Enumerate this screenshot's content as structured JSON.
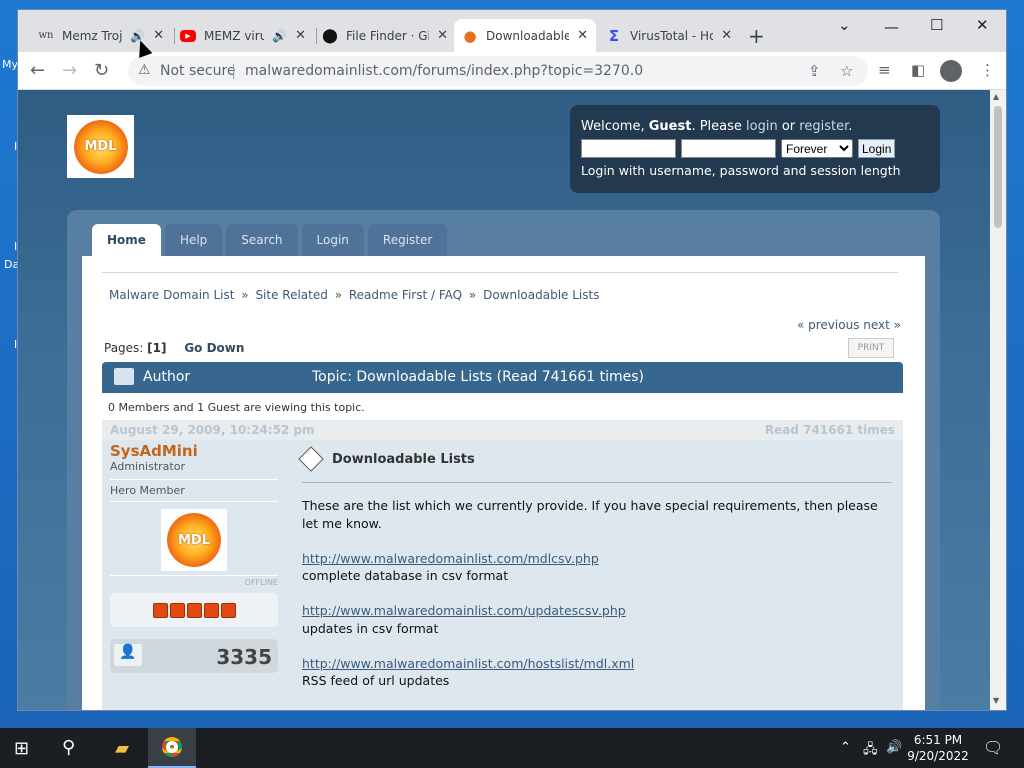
{
  "desktop": {
    "labels": [
      "My",
      "I",
      "I",
      "Da",
      "I"
    ]
  },
  "tabs": [
    {
      "title": "Memz Troj",
      "favicon": "wn",
      "sound": "🔊"
    },
    {
      "title": "MEMZ viru",
      "favicon": "▶",
      "sound": "🔊"
    },
    {
      "title": "File Finder · Gi",
      "favicon": "⬤"
    },
    {
      "title": "Downloadable",
      "favicon": "●"
    },
    {
      "title": "VirusTotal - Ho",
      "favicon": "Σ"
    }
  ],
  "tab_close": "✕",
  "new_tab": "+",
  "window_controls": {
    "dropdown": "⌄",
    "minimize": "—",
    "maximize": "☐",
    "close": "✕"
  },
  "toolbar": {
    "back": "←",
    "forward": "→",
    "reload": "↻",
    "not_secure": "Not secure",
    "url": "malwaredomainlist.com/forums/index.php?topic=3270.0"
  },
  "site": {
    "logo_text": "MDL",
    "userbox": {
      "welcome_prefix": "Welcome, ",
      "guest": "Guest",
      "please": ". Please ",
      "login": "login",
      "or": " or ",
      "register": "register",
      "period": ".",
      "duration": "Forever",
      "login_button": "Login",
      "hint": "Login with username, password and session length"
    },
    "menu": [
      "Home",
      "Help",
      "Search",
      "Login",
      "Register"
    ],
    "breadcrumb": [
      "Malware Domain List",
      "Site Related",
      "Readme First / FAQ",
      "Downloadable Lists"
    ],
    "breadcrumb_sep": "»",
    "prev_next": "« previous next »",
    "pages_label": "Pages: ",
    "pages_current": "[1]",
    "go_down": "Go Down",
    "print": "PRINT",
    "author_label": "Author",
    "topic_label": "Topic: Downloadable Lists  (Read 741661 times)",
    "viewing": "0 Members and 1 Guest are viewing this topic.",
    "post": {
      "date": "August 29, 2009, 10:24:52 pm",
      "read": "Read 741661 times",
      "poster_name": "SysAdMini",
      "poster_title": "Administrator",
      "poster_group": "Hero Member",
      "status": "OFFLINE",
      "post_count": "3335",
      "subject": "Downloadable Lists",
      "intro": "These are the list which we currently provide. If you have special requirements, then please let me know.",
      "link1": "http://www.malwaredomainlist.com/mdlcsv.php",
      "desc1": "complete database in csv format",
      "link2": "http://www.malwaredomainlist.com/updatescsv.php",
      "desc2": "updates in csv format",
      "link3": "http://www.malwaredomainlist.com/hostslist/mdl.xml",
      "desc3": "RSS feed of url updates"
    }
  },
  "taskbar": {
    "time": "6:51 PM",
    "date": "9/20/2022"
  }
}
